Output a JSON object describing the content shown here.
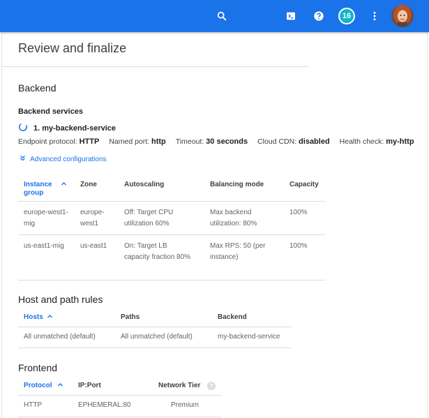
{
  "header": {
    "badge_count": "16",
    "icons": [
      "search-icon",
      "cloud-shell-icon",
      "help-icon",
      "more-vert-icon"
    ],
    "brand_color": "#1a73e8"
  },
  "page": {
    "title": "Review and finalize"
  },
  "backend": {
    "heading": "Backend",
    "services_heading": "Backend services",
    "service_name": "1. my-backend-service",
    "meta": [
      {
        "label": "Endpoint protocol:",
        "value": "HTTP"
      },
      {
        "label": "Named port:",
        "value": "http"
      },
      {
        "label": "Timeout:",
        "value": "30 seconds"
      },
      {
        "label": "Cloud CDN:",
        "value": "disabled"
      },
      {
        "label": "Health check:",
        "value": "my-http"
      }
    ],
    "advanced_link": "Advanced configurations",
    "table": {
      "headers": [
        "Instance group",
        "Zone",
        "Autoscaling",
        "Balancing mode",
        "Capacity"
      ],
      "rows": [
        [
          "europe-west1-mig",
          "europe-west1",
          "Off: Target CPU utilization 60%",
          "Max backend utilization: 80%",
          "100%"
        ],
        [
          "us-east1-mig",
          "us-east1",
          "On: Target LB capacity fraction 80%",
          "Max RPS: 50 (per instance)",
          "100%"
        ]
      ]
    }
  },
  "host_rules": {
    "heading": "Host and path rules",
    "headers": [
      "Hosts",
      "Paths",
      "Backend"
    ],
    "rows": [
      [
        "All unmatched (default)",
        "All unmatched (default)",
        "my-backend-service"
      ]
    ]
  },
  "frontend": {
    "heading": "Frontend",
    "headers": [
      "Protocol",
      "IP:Port",
      "Network Tier"
    ],
    "rows": [
      [
        "HTTP",
        "EPHEMERAL:80",
        "Premium"
      ]
    ]
  }
}
